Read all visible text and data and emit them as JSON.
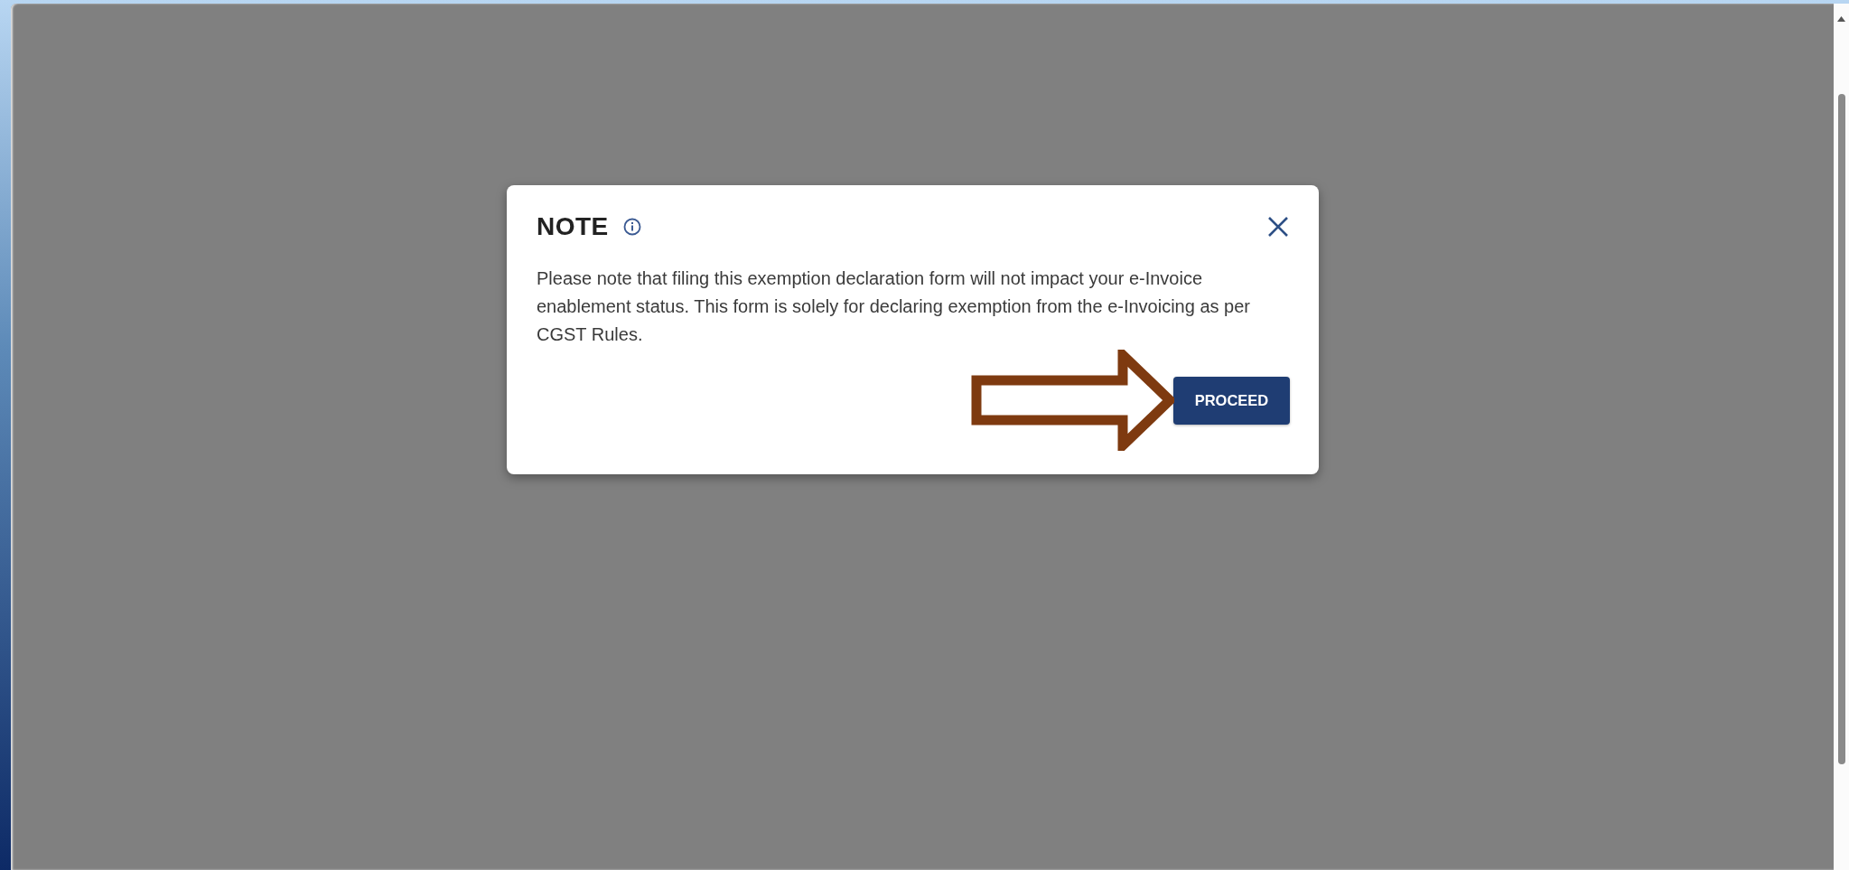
{
  "dialog": {
    "title": "NOTE",
    "message": "Please note that filing this exemption declaration form will not impact your e-Invoice enablement status. This form is solely for declaring exemption from the e-Invoicing as per CGST Rules.",
    "buttons": [
      {
        "label": "PROCEED"
      }
    ]
  }
}
